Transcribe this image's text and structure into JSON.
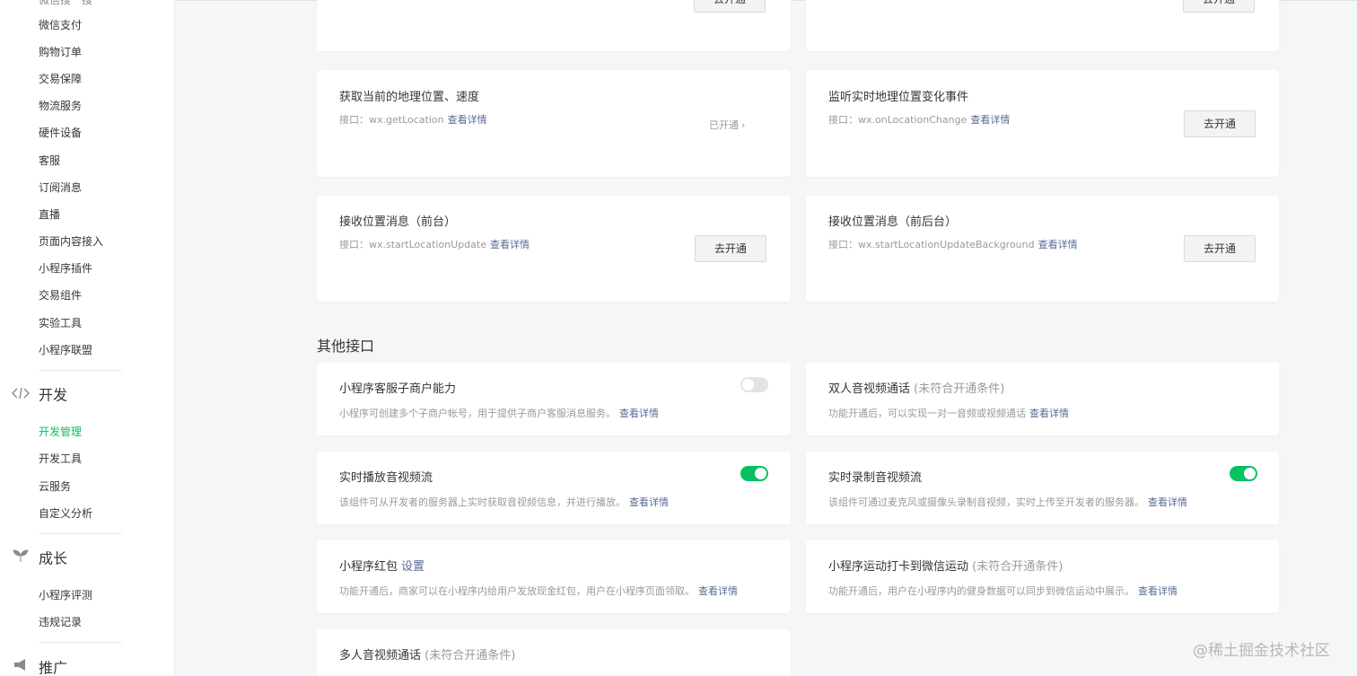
{
  "sidebar": {
    "clipped_item": "微信搜一搜",
    "items_group1": [
      "微信支付",
      "购物订单",
      "交易保障",
      "物流服务",
      "硬件设备",
      "客服",
      "订阅消息",
      "直播",
      "页面内容接入",
      "小程序插件",
      "交易组件",
      "实验工具",
      "小程序联盟"
    ],
    "section_dev": {
      "icon": "code-icon",
      "label": "开发"
    },
    "items_dev": [
      "开发管理",
      "开发工具",
      "云服务",
      "自定义分析"
    ],
    "active_item": "开发管理",
    "section_growth": {
      "icon": "sprout-icon",
      "label": "成长"
    },
    "items_growth": [
      "小程序评测",
      "违规记录"
    ],
    "section_promo": {
      "icon": "megaphone-icon",
      "label": "推广"
    }
  },
  "location_cards": [
    {
      "title": "获取当前的地理位置、速度",
      "desc_prefix": "接口：wx.getLocation",
      "link": "查看详情",
      "status": "已开通"
    },
    {
      "title": "监听实时地理位置变化事件",
      "desc_prefix": "接口：wx.onLocationChange",
      "link": "查看详情",
      "button": "去开通"
    },
    {
      "title": "接收位置消息（前台）",
      "desc_prefix": "接口：wx.startLocationUpdate",
      "link": "查看详情",
      "button": "去开通"
    },
    {
      "title": "接收位置消息（前后台）",
      "desc_prefix": "接口：wx.startLocationUpdateBackground",
      "link": "查看详情",
      "button": "去开通"
    }
  ],
  "top_cards_button": "去开通",
  "other_section": {
    "heading": "其他接口",
    "cards": [
      {
        "title": "小程序客服子商户能力",
        "desc": "小程序可创建多个子商户帐号，用于提供子商户客服消息服务。",
        "link": "查看详情",
        "switch_on": false
      },
      {
        "title": "双人音视频通话",
        "note": "(未符合开通条件)",
        "desc": "功能开通后，可以实现一对一音频或视频通话",
        "link": "查看详情"
      },
      {
        "title": "实时播放音视频流",
        "desc": "该组件可从开发者的服务器上实时获取音视频信息，并进行播放。",
        "link": "查看详情",
        "switch_on": true
      },
      {
        "title": "实时录制音视频流",
        "desc": "该组件可通过麦克风或摄像头录制音视频，实时上传至开发者的服务器。",
        "link": "查看详情",
        "switch_on": true
      },
      {
        "title": "小程序红包",
        "title_link": "设置",
        "desc": "功能开通后，商家可以在小程序内给用户发放现金红包，用户在小程序页面领取。",
        "link": "查看详情"
      },
      {
        "title": "小程序运动打卡到微信运动",
        "note": "(未符合开通条件)",
        "desc": "功能开通后，用户在小程序内的健身数据可以同步到微信运动中展示。",
        "link": "查看详情"
      },
      {
        "title": "多人音视频通话",
        "note": "(未符合开通条件)"
      }
    ]
  },
  "colors": {
    "accent_green": "#07c160",
    "link_blue": "#576b95",
    "muted": "#9a9a9a"
  },
  "watermark": "@稀土掘金技术社区"
}
